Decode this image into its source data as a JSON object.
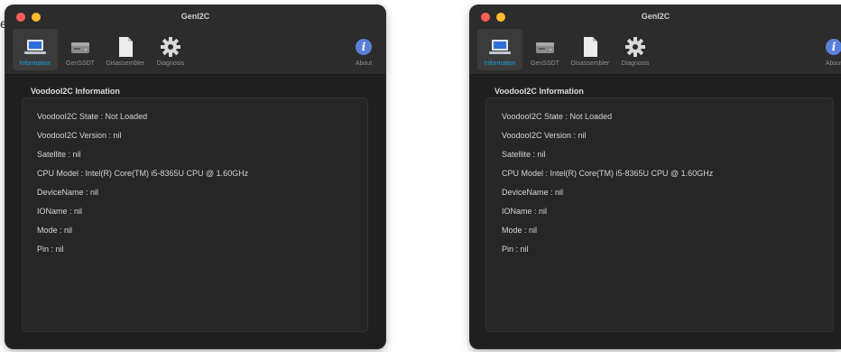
{
  "stray_text": "er",
  "window": {
    "title": "GenI2C",
    "toolbar": [
      {
        "label": "Information",
        "icon": "laptop-icon",
        "active": true
      },
      {
        "label": "GenSSDT",
        "icon": "drive-icon",
        "active": false
      },
      {
        "label": "Disassembler",
        "icon": "document-icon",
        "active": false
      },
      {
        "label": "Diagnosis",
        "icon": "gear-icon",
        "active": false
      }
    ],
    "about_label": "About",
    "section_title": "VoodooI2C Information",
    "info_rows": [
      "VoodooI2C State : Not Loaded",
      "VoodooI2C Version : nil",
      "Satellite : nil",
      "CPU Model : Intel(R) Core(TM) i5-8365U CPU @ 1.60GHz",
      "DeviceName : nil",
      "IOName : nil",
      "Mode : nil",
      "Pin : nil"
    ]
  },
  "colors": {
    "accent": "#16a6d8",
    "window_bg": "#1f1f1f",
    "titlebar_bg": "#2c2c2c",
    "close": "#ff5f57",
    "minimize": "#febc2e",
    "about_icon": "#5a7fd8"
  }
}
